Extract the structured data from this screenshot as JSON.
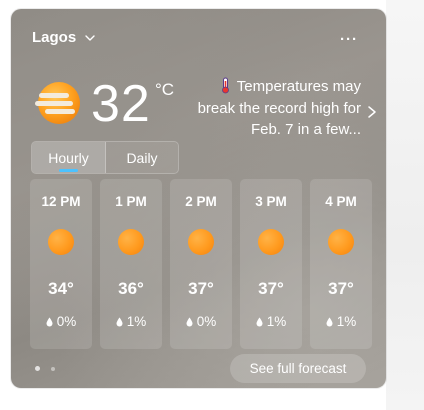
{
  "location": {
    "name": "Lagos"
  },
  "current": {
    "temperature": "32",
    "unit": "°C",
    "condition_icon": "sunny-haze-icon",
    "alert": {
      "text": "Temperatures may break the record high for Feb. 7 in a few...",
      "icon": "thermometer-icon"
    }
  },
  "tabs": [
    {
      "label": "Hourly",
      "selected": true
    },
    {
      "label": "Daily",
      "selected": false
    }
  ],
  "hourly": [
    {
      "time": "12 PM",
      "icon": "sun-icon",
      "temp": "34°",
      "precip": "0%"
    },
    {
      "time": "1 PM",
      "icon": "sun-icon",
      "temp": "36°",
      "precip": "1%"
    },
    {
      "time": "2 PM",
      "icon": "sun-icon",
      "temp": "37°",
      "precip": "0%"
    },
    {
      "time": "3 PM",
      "icon": "sun-icon",
      "temp": "37°",
      "precip": "1%"
    },
    {
      "time": "4 PM",
      "icon": "sun-icon",
      "temp": "37°",
      "precip": "1%"
    }
  ],
  "footer": {
    "see_full_forecast": "See full forecast"
  },
  "colors": {
    "accent": "#4cc2ff",
    "sun": "#ff9a1e"
  }
}
